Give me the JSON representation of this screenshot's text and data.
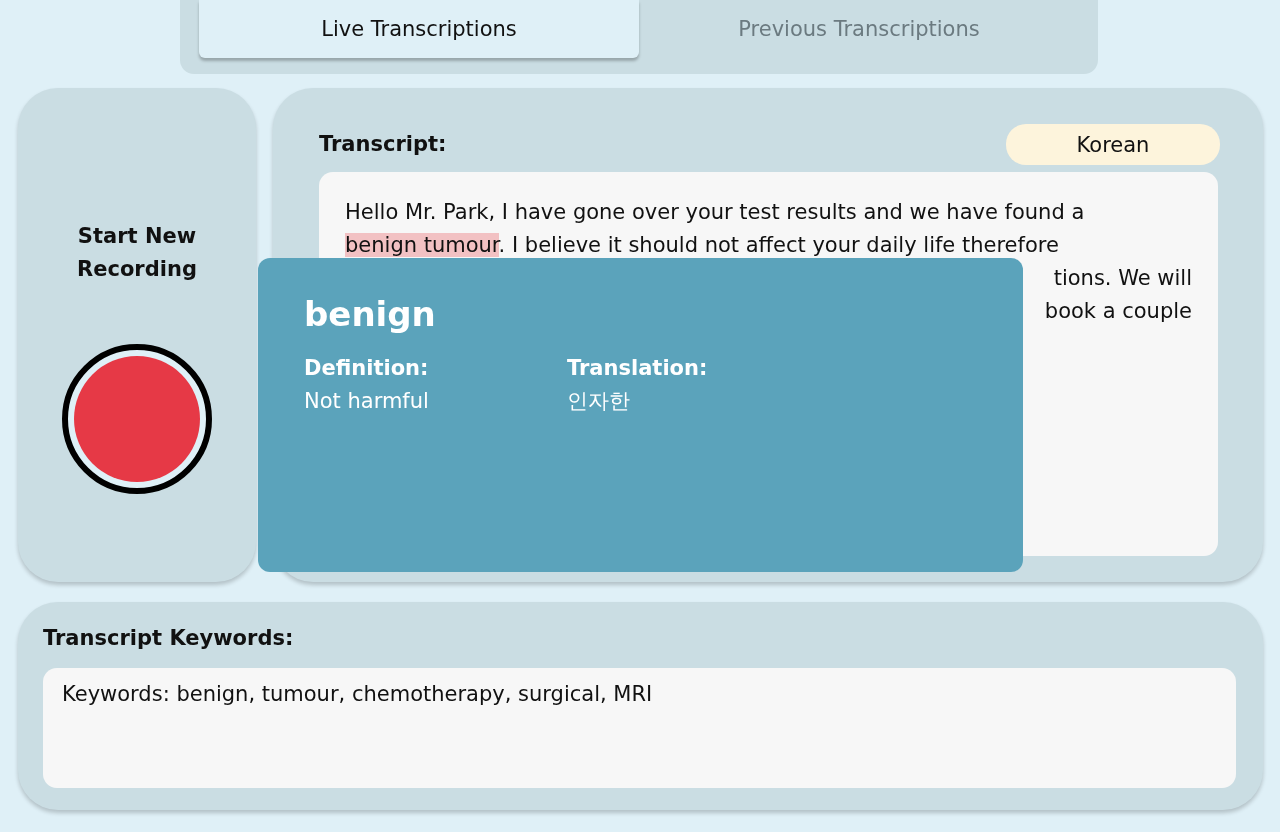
{
  "tabs": [
    {
      "label": "Live Transcriptions",
      "selected": true
    },
    {
      "label": "Previous Transcriptions",
      "selected": false
    }
  ],
  "recorder": {
    "label": "Start New Recording",
    "recording": false
  },
  "transcript": {
    "heading": "Transcript:",
    "language": "Korean",
    "lines": [
      {
        "parts": [
          {
            "text": "Hello Mr. Park, I have gone over your test results and we have found a",
            "highlighted": false
          }
        ],
        "covered": false
      },
      {
        "parts": [
          {
            "text": "benign tumour",
            "highlighted": true
          },
          {
            "text": ". I believe it should not affect your daily life therefore",
            "highlighted": false
          }
        ],
        "covered": false
      },
      {
        "parts": [
          {
            "text": "tions. We will",
            "highlighted": false
          }
        ],
        "covered": true
      },
      {
        "parts": [
          {
            "text": "book a couple",
            "highlighted": false
          }
        ],
        "covered": true
      }
    ]
  },
  "popup": {
    "term": "benign",
    "definition_label": "Definition:",
    "definition": "Not harmful",
    "translation_label": "Translation:",
    "translation": "인자한"
  },
  "keywords": {
    "heading": "Transcript Keywords:",
    "text": "Keywords: benign, tumour, chemotherapy, surgical, MRI"
  }
}
